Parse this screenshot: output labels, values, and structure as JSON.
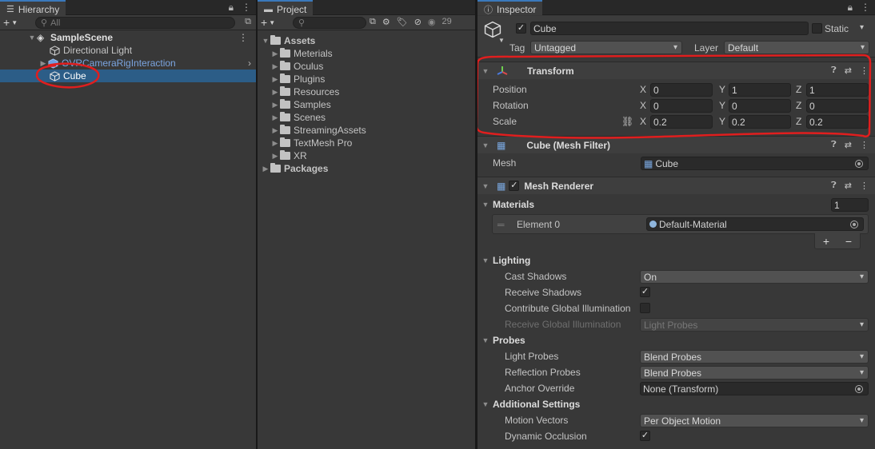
{
  "hierarchy": {
    "tab_label": "Hierarchy",
    "search_placeholder": "All",
    "scene_name": "SampleScene",
    "items": [
      {
        "label": "Directional Light"
      },
      {
        "label": "OVRCameraRigInteraction"
      },
      {
        "label": "Cube"
      }
    ]
  },
  "project": {
    "tab_label": "Project",
    "hidden_count": "29",
    "assets_label": "Assets",
    "folders": [
      "Meterials",
      "Oculus",
      "Plugins",
      "Resources",
      "Samples",
      "Scenes",
      "StreamingAssets",
      "TextMesh Pro",
      "XR"
    ],
    "packages_label": "Packages"
  },
  "inspector": {
    "tab_label": "Inspector",
    "object_name": "Cube",
    "static_label": "Static",
    "tag_label": "Tag",
    "tag_value": "Untagged",
    "layer_label": "Layer",
    "layer_value": "Default",
    "transform": {
      "title": "Transform",
      "position_label": "Position",
      "rotation_label": "Rotation",
      "scale_label": "Scale",
      "axis_x": "X",
      "axis_y": "Y",
      "axis_z": "Z",
      "position": {
        "x": "0",
        "y": "1",
        "z": "1"
      },
      "rotation": {
        "x": "0",
        "y": "0",
        "z": "0"
      },
      "scale": {
        "x": "0.2",
        "y": "0.2",
        "z": "0.2"
      }
    },
    "mesh_filter": {
      "title": "Cube (Mesh Filter)",
      "mesh_label": "Mesh",
      "mesh_value": "Cube"
    },
    "mesh_renderer": {
      "title": "Mesh Renderer",
      "materials_label": "Materials",
      "materials_count": "1",
      "element_label": "Element 0",
      "element_value": "Default-Material",
      "add_label": "+",
      "remove_label": "−",
      "lighting_label": "Lighting",
      "cast_shadows_label": "Cast Shadows",
      "cast_shadows_value": "On",
      "receive_shadows_label": "Receive Shadows",
      "contribute_gi_label": "Contribute Global Illumination",
      "receive_gi_label": "Receive Global Illumination",
      "receive_gi_value": "Light Probes",
      "probes_label": "Probes",
      "light_probes_label": "Light Probes",
      "light_probes_value": "Blend Probes",
      "reflection_probes_label": "Reflection Probes",
      "reflection_probes_value": "Blend Probes",
      "anchor_override_label": "Anchor Override",
      "anchor_override_value": "None (Transform)",
      "additional_label": "Additional Settings",
      "motion_vectors_label": "Motion Vectors",
      "motion_vectors_value": "Per Object Motion",
      "dynamic_occlusion_label": "Dynamic Occlusion"
    }
  },
  "colors": {
    "selection": "#2c5d87",
    "annotation": "#e01e1e",
    "tab_accent": "#3a79bb"
  }
}
